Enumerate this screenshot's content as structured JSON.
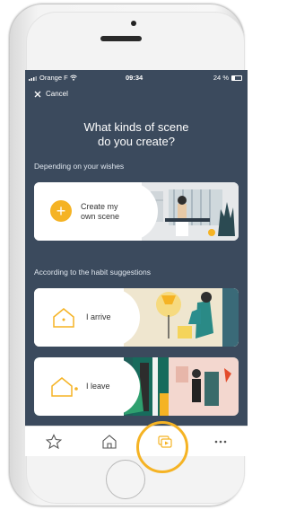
{
  "status_bar": {
    "carrier": "Orange F",
    "time": "09:34",
    "battery": "24 %"
  },
  "header": {
    "cancel_label": "Cancel",
    "title_line1": "What kinds of scene",
    "title_line2": "do you create?"
  },
  "sections": [
    {
      "label": "Depending on your wishes"
    },
    {
      "label": "According to the habit suggestions"
    }
  ],
  "cards": [
    {
      "label_line1": "Create my",
      "label_line2": "own scene",
      "icon": "plus-icon"
    },
    {
      "label": "I arrive",
      "icon": "house-arrive-icon"
    },
    {
      "label": "I leave",
      "icon": "house-leave-icon"
    }
  ],
  "tab_bar": {
    "items": [
      {
        "icon": "star-icon"
      },
      {
        "icon": "home-icon"
      },
      {
        "icon": "scenes-icon",
        "active": true
      },
      {
        "icon": "more-icon"
      }
    ]
  },
  "colors": {
    "screen_bg": "#3b4a5d",
    "accent": "#f5b324",
    "card_white": "#ffffff"
  }
}
